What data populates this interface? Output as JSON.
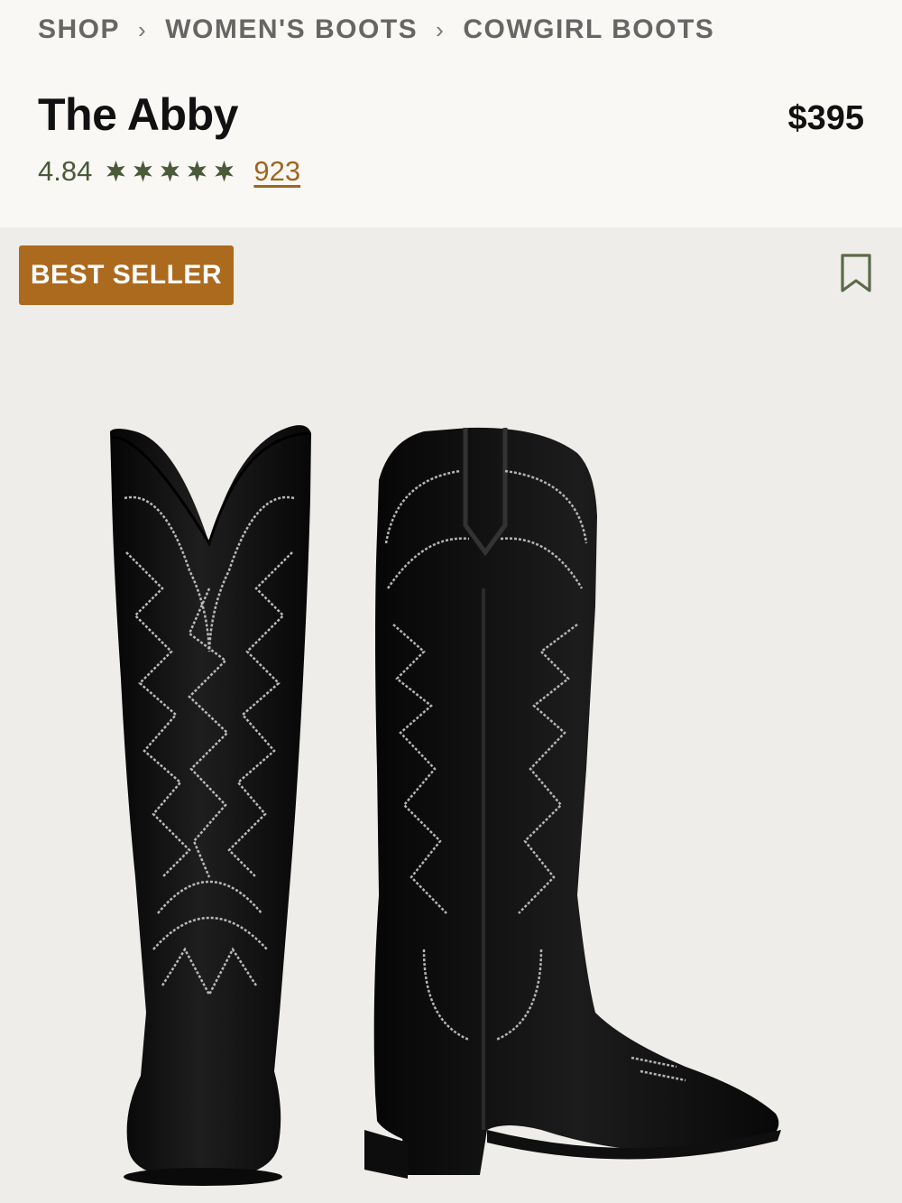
{
  "breadcrumb": {
    "items": [
      {
        "label": "SHOP"
      },
      {
        "label": "WOMEN'S BOOTS"
      },
      {
        "label": "COWGIRL BOOTS"
      }
    ],
    "separator": "›"
  },
  "product": {
    "title": "The Abby",
    "price": "$395",
    "rating": "4.84",
    "stars": 5,
    "review_count": "923"
  },
  "gallery": {
    "badge": "BEST SELLER",
    "bookmark_icon": "bookmark-icon"
  },
  "colors": {
    "background": "#faf8f4",
    "gallery_background": "#efede9",
    "badge": "#ac6a1e",
    "star": "#4a5a3a",
    "review_link": "#a0661e",
    "breadcrumb": "#666666"
  }
}
